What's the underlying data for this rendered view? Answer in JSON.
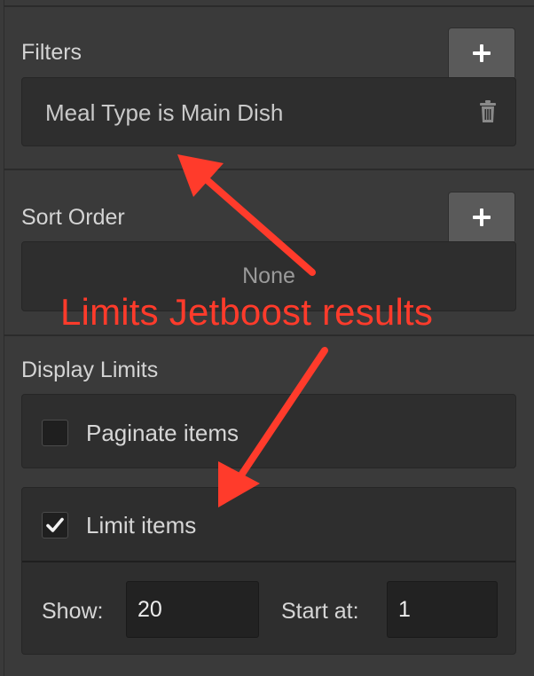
{
  "filters": {
    "title": "Filters",
    "add_label": "+",
    "items": [
      {
        "text": "Meal Type is Main Dish"
      }
    ]
  },
  "sort_order": {
    "title": "Sort Order",
    "add_label": "+",
    "value": "None"
  },
  "display_limits": {
    "title": "Display Limits",
    "paginate": {
      "label": "Paginate items",
      "checked": false
    },
    "limit": {
      "label": "Limit items",
      "checked": true,
      "show_label": "Show:",
      "show_value": "20",
      "start_label": "Start at:",
      "start_value": "1"
    }
  },
  "annotation": {
    "text": "Limits Jetboost results",
    "color": "#ff3b2b"
  },
  "colors": {
    "panel_bg": "#3a3a3a",
    "box_bg": "#2e2e2e",
    "button_bg": "#5a5a5a"
  }
}
